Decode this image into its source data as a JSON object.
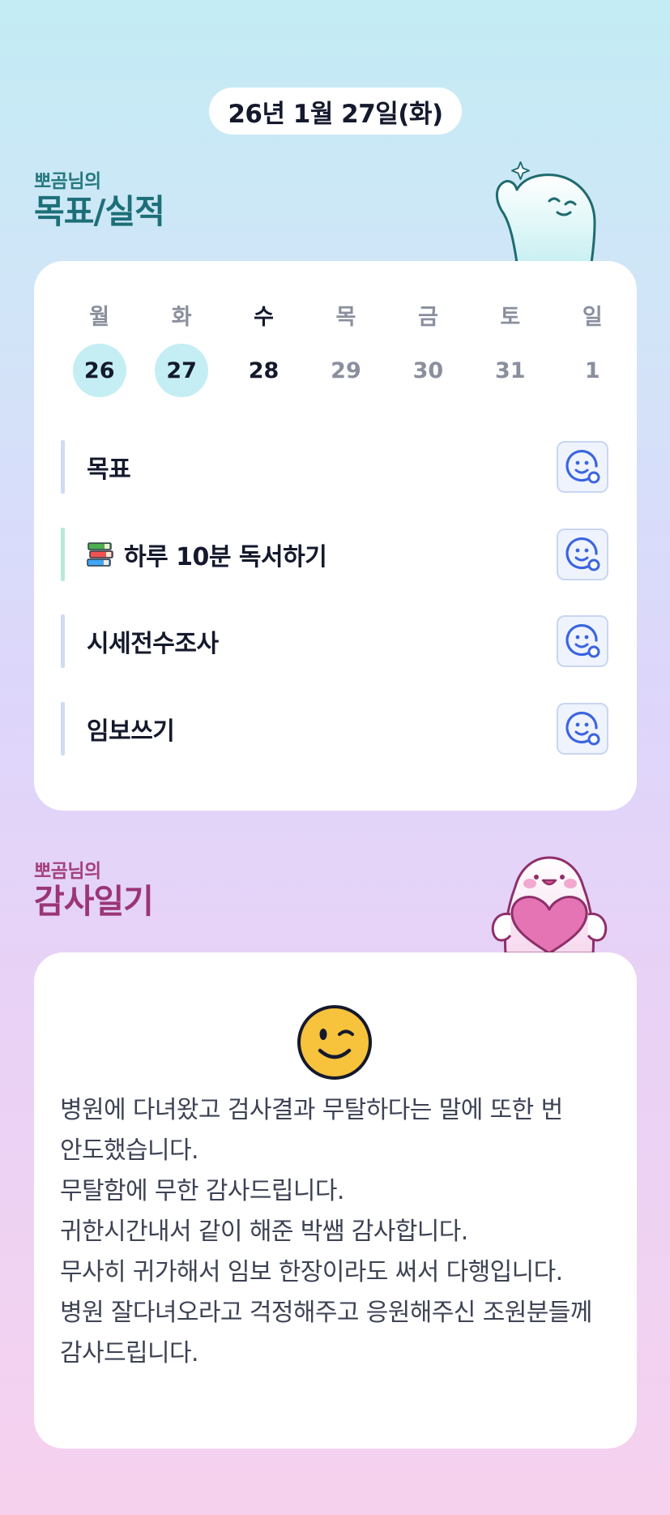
{
  "date": "26년 1월 27일(화)",
  "goals_section": {
    "subtitle": "뽀곰님의",
    "title": "목표/실적"
  },
  "week": [
    {
      "name": "월",
      "num": "26",
      "status": "done"
    },
    {
      "name": "화",
      "num": "27",
      "status": "done"
    },
    {
      "name": "수",
      "num": "28",
      "status": "today"
    },
    {
      "name": "목",
      "num": "29",
      "status": "future"
    },
    {
      "name": "금",
      "num": "30",
      "status": "future"
    },
    {
      "name": "토",
      "num": "31",
      "status": "future"
    },
    {
      "name": "일",
      "num": "1",
      "status": "future"
    }
  ],
  "goals": [
    {
      "label": "목표",
      "icon": "",
      "bar": "blue"
    },
    {
      "label": "하루 10분 독서하기",
      "icon": "books-icon",
      "bar": "green"
    },
    {
      "label": "시세전수조사",
      "icon": "",
      "bar": "blue"
    },
    {
      "label": "임보쓰기",
      "icon": "",
      "bar": "blue"
    }
  ],
  "thanks_section": {
    "subtitle": "뽀곰님의",
    "title": "감사일기",
    "mood_icon": "winking-face-icon",
    "lines": [
      "병원에 다녀왔고 검사결과 무탈하다는 말에 또한 번 안도했습니다.",
      "무탈함에 무한 감사드립니다.",
      "귀한시간내서 같이 해준 박쌤 감사합니다.",
      "무사히 귀가해서 임보 한장이라도 써서 다행입니다.",
      "병원 잘다녀오라고 걱정해주고 응원해주신 조원분들께 감사드립니다."
    ]
  },
  "colors": {
    "goal_heading": "#1c6f78",
    "thanks_heading": "#9b3577",
    "done_day": "#c4eef3",
    "accent_blue": "#3b64e0"
  }
}
